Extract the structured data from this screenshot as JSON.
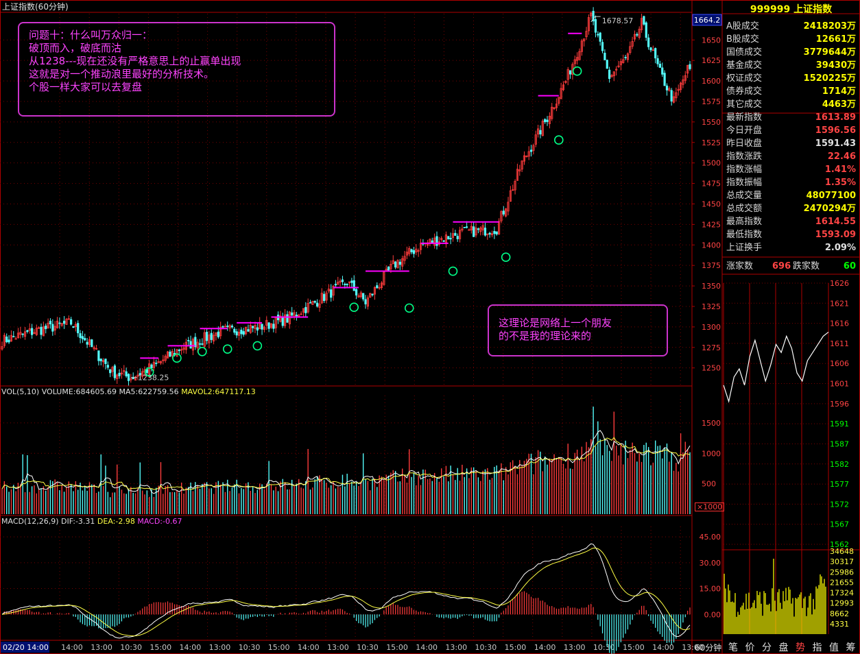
{
  "header": {
    "title": "上证指数(60分钟)"
  },
  "price": {
    "yticks": [
      1250,
      1275,
      1300,
      1325,
      1350,
      1375,
      1400,
      1425,
      1450,
      1475,
      1500,
      1525,
      1550,
      1575,
      1600,
      1625,
      1650
    ],
    "current_tag": "1664.2",
    "high_label": "1678.57",
    "low_label": "1238.25",
    "colors": {
      "up": "#ff3c3c",
      "down": "#54fcfc",
      "resist": "#ff00ff",
      "circle": "#00ff88"
    }
  },
  "volume": {
    "header": "VOL(5,10)",
    "volume_text": "VOLUME:684605.69",
    "ma5_text": "MA5:622759.56",
    "mavol2_text": "MAVOL2:647117.13",
    "yticks": [
      500,
      1000,
      1500
    ],
    "unit": "×1000"
  },
  "macd": {
    "header": "MACD(12,26,9)",
    "dif_text": "DIF:-3.31",
    "dea_text": "DEA:-2.98",
    "macd_text": "MACD:-0.67",
    "yticks": [
      "45.00",
      "30.00",
      "15.00",
      "0.00"
    ]
  },
  "time_axis": {
    "period": "60分钟",
    "labels": [
      "02/20 14:00",
      "14:00",
      "13:00",
      "10:30",
      "15:00",
      "14:00",
      "13:00",
      "10:30",
      "15:00",
      "14:00",
      "13:00",
      "10:30",
      "15:00",
      "14:00",
      "13:00",
      "10:30",
      "15:00",
      "14:00",
      "13:00",
      "10:30",
      "15:00",
      "14:00",
      "13:00"
    ]
  },
  "annotations": {
    "box1": [
      "问题十：什么叫万众归一：",
      "破顶而入，破底而沽",
      "从1238---现在还没有严格意思上的止赢单出现",
      "这就是对一个推动浪里最好的分析技术。",
      "个股一样大家可以去复盘"
    ],
    "box2": [
      "这理论是网络上一个朋友",
      "的不是我的理论来的"
    ]
  },
  "side_panel": {
    "title": "999999 上证指数",
    "rows": [
      {
        "k": "A股成交",
        "v": "2418203万",
        "c": "#ffff00"
      },
      {
        "k": "B股成交",
        "v": "12661万",
        "c": "#ffff00"
      },
      {
        "k": "国债成交",
        "v": "3779644万",
        "c": "#ffff00"
      },
      {
        "k": "基金成交",
        "v": "39430万",
        "c": "#ffff00"
      },
      {
        "k": "权证成交",
        "v": "1520225万",
        "c": "#ffff00"
      },
      {
        "k": "债券成交",
        "v": "1714万",
        "c": "#ffff00"
      },
      {
        "k": "其它成交",
        "v": "4463万",
        "c": "#ffff00"
      },
      {
        "k": "最新指数",
        "v": "1613.89",
        "c": "#ff4444"
      },
      {
        "k": "今日开盘",
        "v": "1596.56",
        "c": "#ff4444"
      },
      {
        "k": "昨日收盘",
        "v": "1591.43",
        "c": "#e0e0e0"
      },
      {
        "k": "指数涨跌",
        "v": "22.46",
        "c": "#ff4444"
      },
      {
        "k": "指数涨幅",
        "v": "1.41%",
        "c": "#ff4444"
      },
      {
        "k": "指数振幅",
        "v": "1.35%",
        "c": "#ff4444"
      },
      {
        "k": "总成交量",
        "v": "48077100",
        "c": "#ffff00"
      },
      {
        "k": "总成交额",
        "v": "2470294万",
        "c": "#ffff00"
      },
      {
        "k": "最高指数",
        "v": "1614.55",
        "c": "#ff4444"
      },
      {
        "k": "最低指数",
        "v": "1593.09",
        "c": "#ff4444"
      },
      {
        "k": "上证换手",
        "v": "2.09%",
        "c": "#e0e0e0"
      }
    ],
    "rise_label": "涨家数",
    "rise_value": "696",
    "fall_label": "跌家数",
    "fall_value": "60",
    "intraday_yticks": [
      "1626",
      "1621",
      "1616",
      "1611",
      "1606",
      "1601",
      "1596",
      "1591",
      "1587",
      "1582",
      "1577",
      "1572",
      "1567",
      "1562"
    ],
    "intraday_vol_ticks": [
      "34648",
      "30317",
      "25986",
      "21655",
      "17324",
      "12993",
      "8662",
      "4331"
    ],
    "tabs": [
      "笔",
      "价",
      "分",
      "盘",
      "势",
      "指",
      "值",
      "筹"
    ]
  },
  "chart_data": {
    "type": "candlestick",
    "title": "上证指数(60分钟)",
    "x_range": [
      "02/20 14:00",
      "latest"
    ],
    "ylim": [
      1228,
      1682
    ],
    "trend_points": [
      {
        "bar": 0,
        "price": 1283
      },
      {
        "bar": 14,
        "price": 1295
      },
      {
        "bar": 30,
        "price": 1305
      },
      {
        "bar": 48,
        "price": 1245
      },
      {
        "bar": 56,
        "price": 1238.25
      },
      {
        "bar": 66,
        "price": 1252
      },
      {
        "bar": 78,
        "price": 1275
      },
      {
        "bar": 96,
        "price": 1295
      },
      {
        "bar": 112,
        "price": 1300
      },
      {
        "bar": 124,
        "price": 1310
      },
      {
        "bar": 136,
        "price": 1330
      },
      {
        "bar": 150,
        "price": 1355
      },
      {
        "bar": 158,
        "price": 1330
      },
      {
        "bar": 170,
        "price": 1375
      },
      {
        "bar": 182,
        "price": 1400
      },
      {
        "bar": 200,
        "price": 1415
      },
      {
        "bar": 215,
        "price": 1420
      },
      {
        "bar": 226,
        "price": 1500
      },
      {
        "bar": 236,
        "price": 1550
      },
      {
        "bar": 245,
        "price": 1600
      },
      {
        "bar": 256,
        "price": 1678.57
      },
      {
        "bar": 264,
        "price": 1605
      },
      {
        "bar": 272,
        "price": 1630
      },
      {
        "bar": 278,
        "price": 1670
      },
      {
        "bar": 286,
        "price": 1610
      },
      {
        "bar": 292,
        "price": 1575
      },
      {
        "bar": 298,
        "price": 1613.89
      }
    ],
    "resistance_levels": [
      {
        "price": 1262,
        "from_bar": 60,
        "to_bar": 68
      },
      {
        "price": 1277,
        "from_bar": 72,
        "to_bar": 84
      },
      {
        "price": 1298,
        "from_bar": 86,
        "to_bar": 98
      },
      {
        "price": 1305,
        "from_bar": 102,
        "to_bar": 113
      },
      {
        "price": 1312,
        "from_bar": 117,
        "to_bar": 133
      },
      {
        "price": 1348,
        "from_bar": 144,
        "to_bar": 155
      },
      {
        "price": 1368,
        "from_bar": 158,
        "to_bar": 177
      },
      {
        "price": 1402,
        "from_bar": 182,
        "to_bar": 194
      },
      {
        "price": 1428,
        "from_bar": 196,
        "to_bar": 216
      },
      {
        "price": 1582,
        "from_bar": 233,
        "to_bar": 242
      },
      {
        "price": 1658,
        "from_bar": 246,
        "to_bar": 252
      }
    ],
    "support_marks": [
      {
        "price": 1245,
        "bar": 64
      },
      {
        "price": 1262,
        "bar": 76
      },
      {
        "price": 1270,
        "bar": 87
      },
      {
        "price": 1273,
        "bar": 98
      },
      {
        "price": 1277,
        "bar": 111
      },
      {
        "price": 1324,
        "bar": 153
      },
      {
        "price": 1323,
        "bar": 177
      },
      {
        "price": 1368,
        "bar": 196
      },
      {
        "price": 1385,
        "bar": 219
      },
      {
        "price": 1528,
        "bar": 242
      },
      {
        "price": 1612,
        "bar": 250
      }
    ],
    "volume_ylim": [
      0,
      1950
    ],
    "macd_ylim": [
      -15,
      51
    ]
  }
}
